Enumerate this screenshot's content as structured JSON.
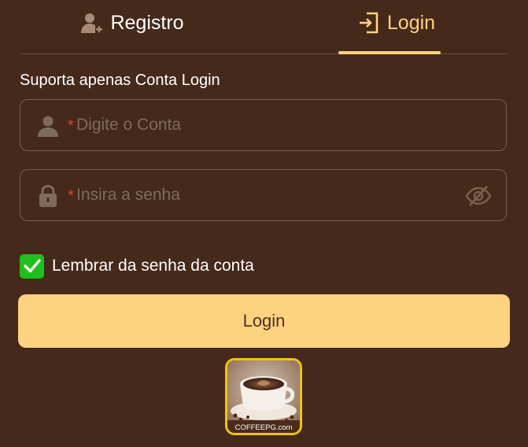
{
  "tabs": [
    {
      "label": "Registro",
      "icon": "user-add-icon",
      "active": false
    },
    {
      "label": "Login",
      "icon": "login-door-icon",
      "active": true
    }
  ],
  "form": {
    "subtitle": "Suporta apenas Conta Login",
    "required_mark": "*",
    "account": {
      "placeholder": "Digite o Conta",
      "value": "",
      "icon": "user-icon"
    },
    "password": {
      "placeholder": "Insira a senha",
      "value": "",
      "icon": "lock-icon",
      "toggle_icon": "eye-off-icon"
    },
    "remember": {
      "label": "Lembrar da senha da conta",
      "checked": true
    },
    "submit_label": "Login"
  },
  "logo": {
    "text": "COFFEEPG.com"
  },
  "colors": {
    "background": "#45291b",
    "accent": "#ffd27f",
    "checkbox": "#1fbf1c",
    "required": "#e5403a",
    "logo_border": "#f1c40f"
  }
}
